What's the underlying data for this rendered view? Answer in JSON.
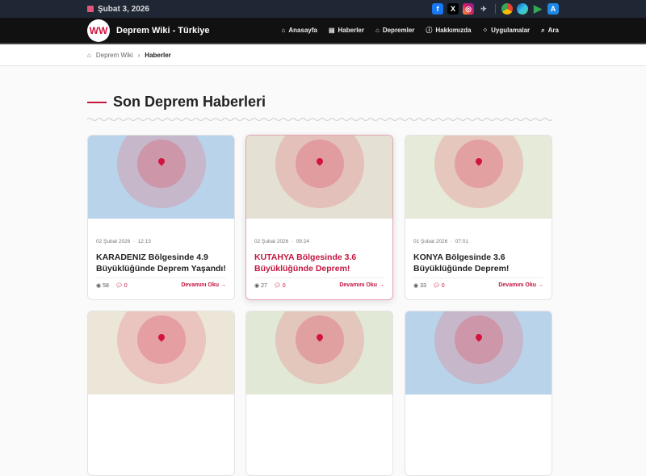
{
  "topbar": {
    "date": "Şubat 3, 2026",
    "social": [
      "facebook-icon",
      "x-icon",
      "instagram-icon",
      "plane-icon"
    ],
    "apps": [
      "chrome-icon",
      "edge-icon",
      "play-store-icon",
      "app-store-icon"
    ]
  },
  "nav": {
    "brand": "Deprem Wiki - Türkiye",
    "logo_text": "WW",
    "items": [
      {
        "label": "Anasayfa",
        "icon": "⌂"
      },
      {
        "label": "Haberler",
        "icon": "▤"
      },
      {
        "label": "Depremler",
        "icon": "⌂"
      },
      {
        "label": "Hakkımızda",
        "icon": "ⓘ"
      },
      {
        "label": "Uygulamalar",
        "icon": "⁘"
      },
      {
        "label": "Ara",
        "icon": "⌕"
      }
    ]
  },
  "breadcrumb": {
    "home": "Deprem Wiki",
    "sep": "›",
    "current": "Haberler"
  },
  "section_title": "Son Deprem Haberleri",
  "cards": [
    {
      "date": "02 Şubat 2026",
      "time": "12:15",
      "title": "KARADENIZ Bölgesinde 4.9 Büyüklüğünde Deprem Yaşandı!",
      "views": "58",
      "comments": "0",
      "read": "Devamını Oku →",
      "map": "#b9d3ea"
    },
    {
      "date": "02 Şubat 2026",
      "time": "09:24",
      "title": "KUTAHYA Bölgesinde 3.6 Büyüklüğünde Deprem!",
      "views": "27",
      "comments": "0",
      "read": "Devamını Oku →",
      "map": "#e4e0d3"
    },
    {
      "date": "01 Şubat 2026",
      "time": "07:01",
      "title": "KONYA Bölgesinde 3.6 Büyüklüğünde Deprem!",
      "views": "33",
      "comments": "0",
      "read": "Devamını Oku →",
      "map": "#e6ead9"
    }
  ],
  "row2_maps": [
    "#ece6d8",
    "#e2e8d6",
    "#b9d3ea"
  ]
}
